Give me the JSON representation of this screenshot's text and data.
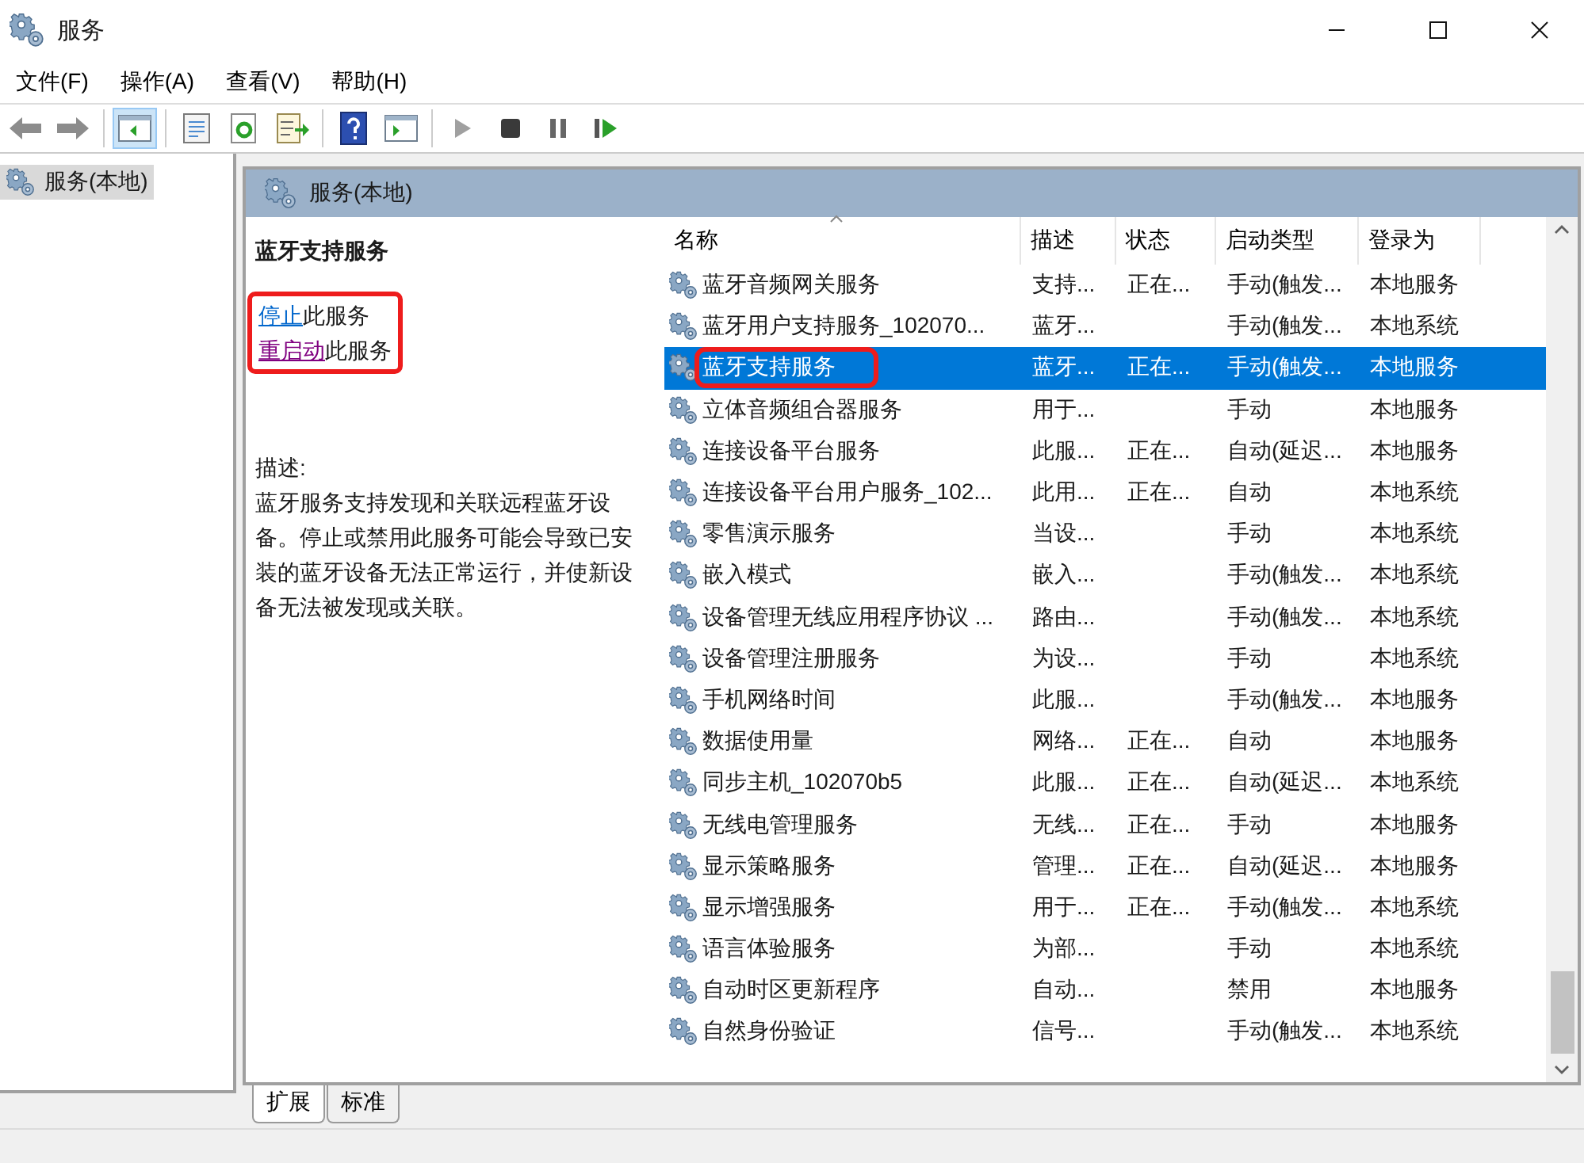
{
  "window": {
    "title": "服务"
  },
  "menu": [
    "文件(F)",
    "操作(A)",
    "查看(V)",
    "帮助(H)"
  ],
  "toolbar": [
    {
      "kind": "back",
      "selected": false
    },
    {
      "kind": "forward",
      "selected": false
    },
    {
      "kind": "sep"
    },
    {
      "kind": "tree",
      "selected": true
    },
    {
      "kind": "sep"
    },
    {
      "kind": "props",
      "selected": false
    },
    {
      "kind": "refresh",
      "selected": false
    },
    {
      "kind": "export",
      "selected": false
    },
    {
      "kind": "sep"
    },
    {
      "kind": "help",
      "selected": false
    },
    {
      "kind": "pane",
      "selected": false
    },
    {
      "kind": "sep"
    },
    {
      "kind": "play",
      "selected": false
    },
    {
      "kind": "stop",
      "selected": false
    },
    {
      "kind": "pause",
      "selected": false
    },
    {
      "kind": "resume",
      "selected": false
    }
  ],
  "tree": [
    {
      "label": "服务(本地)",
      "selected": true
    }
  ],
  "panel": {
    "title": "服务(本地)"
  },
  "details": {
    "title": "蓝牙支持服务",
    "highlighted": true,
    "actions": [
      {
        "link": "停止",
        "rest": "此服务",
        "visited": false
      },
      {
        "link": "重启动",
        "rest": "此服务",
        "visited": true
      }
    ],
    "description_label": "描述:",
    "description": "蓝牙服务支持发现和关联远程蓝牙设备。停止或禁用此服务可能会导致已安装的蓝牙设备无法正常运行，并使新设备无法被发现或关联。"
  },
  "table": {
    "columns": [
      "名称",
      "描述",
      "状态",
      "启动类型",
      "登录为"
    ],
    "rows": [
      {
        "name": "蓝牙音频网关服务",
        "description": "支持...",
        "status": "正在...",
        "startup": "手动(触发...",
        "logon": "本地服务",
        "selected": false,
        "highlighted": false
      },
      {
        "name": "蓝牙用户支持服务_102070...",
        "description": "蓝牙...",
        "status": "",
        "startup": "手动(触发...",
        "logon": "本地系统",
        "selected": false,
        "highlighted": false
      },
      {
        "name": "蓝牙支持服务",
        "description": "蓝牙...",
        "status": "正在...",
        "startup": "手动(触发...",
        "logon": "本地服务",
        "selected": true,
        "highlighted": true
      },
      {
        "name": "立体音频组合器服务",
        "description": "用于...",
        "status": "",
        "startup": "手动",
        "logon": "本地服务",
        "selected": false,
        "highlighted": false
      },
      {
        "name": "连接设备平台服务",
        "description": "此服...",
        "status": "正在...",
        "startup": "自动(延迟...",
        "logon": "本地服务",
        "selected": false,
        "highlighted": false
      },
      {
        "name": "连接设备平台用户服务_102...",
        "description": "此用...",
        "status": "正在...",
        "startup": "自动",
        "logon": "本地系统",
        "selected": false,
        "highlighted": false
      },
      {
        "name": "零售演示服务",
        "description": "当设...",
        "status": "",
        "startup": "手动",
        "logon": "本地系统",
        "selected": false,
        "highlighted": false
      },
      {
        "name": "嵌入模式",
        "description": "嵌入...",
        "status": "",
        "startup": "手动(触发...",
        "logon": "本地系统",
        "selected": false,
        "highlighted": false
      },
      {
        "name": "设备管理无线应用程序协议 ...",
        "description": "路由...",
        "status": "",
        "startup": "手动(触发...",
        "logon": "本地系统",
        "selected": false,
        "highlighted": false
      },
      {
        "name": "设备管理注册服务",
        "description": "为设...",
        "status": "",
        "startup": "手动",
        "logon": "本地系统",
        "selected": false,
        "highlighted": false
      },
      {
        "name": "手机网络时间",
        "description": "此服...",
        "status": "",
        "startup": "手动(触发...",
        "logon": "本地服务",
        "selected": false,
        "highlighted": false
      },
      {
        "name": "数据使用量",
        "description": "网络...",
        "status": "正在...",
        "startup": "自动",
        "logon": "本地服务",
        "selected": false,
        "highlighted": false
      },
      {
        "name": "同步主机_102070b5",
        "description": "此服...",
        "status": "正在...",
        "startup": "自动(延迟...",
        "logon": "本地系统",
        "selected": false,
        "highlighted": false
      },
      {
        "name": "无线电管理服务",
        "description": "无线...",
        "status": "正在...",
        "startup": "手动",
        "logon": "本地服务",
        "selected": false,
        "highlighted": false
      },
      {
        "name": "显示策略服务",
        "description": "管理...",
        "status": "正在...",
        "startup": "自动(延迟...",
        "logon": "本地服务",
        "selected": false,
        "highlighted": false
      },
      {
        "name": "显示增强服务",
        "description": "用于...",
        "status": "正在...",
        "startup": "手动(触发...",
        "logon": "本地系统",
        "selected": false,
        "highlighted": false
      },
      {
        "name": "语言体验服务",
        "description": "为部...",
        "status": "",
        "startup": "手动",
        "logon": "本地系统",
        "selected": false,
        "highlighted": false
      },
      {
        "name": "自动时区更新程序",
        "description": "自动...",
        "status": "",
        "startup": "禁用",
        "logon": "本地服务",
        "selected": false,
        "highlighted": false
      },
      {
        "name": "自然身份验证",
        "description": "信号...",
        "status": "",
        "startup": "手动(触发...",
        "logon": "本地系统",
        "selected": false,
        "highlighted": false
      }
    ]
  },
  "view_tabs": [
    {
      "label": "扩展",
      "selected": true
    },
    {
      "label": "标准",
      "selected": false
    }
  ]
}
